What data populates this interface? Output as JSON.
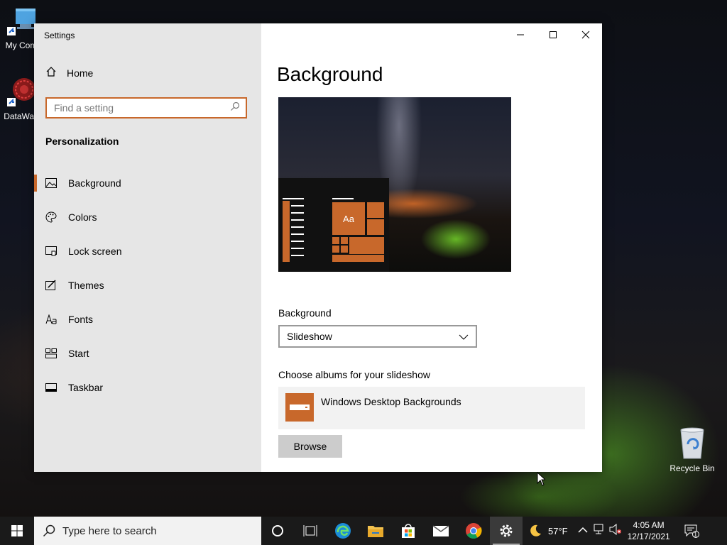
{
  "desktop": {
    "icons": [
      {
        "label": "My Com"
      },
      {
        "label": "DataWag"
      },
      {
        "label": "Recycle Bin"
      }
    ]
  },
  "window": {
    "title": "Settings"
  },
  "sidebar": {
    "home_label": "Home",
    "search_placeholder": "Find a setting",
    "section_title": "Personalization",
    "items": [
      {
        "label": "Background",
        "icon": "picture-icon",
        "active": true
      },
      {
        "label": "Colors",
        "icon": "palette-icon"
      },
      {
        "label": "Lock screen",
        "icon": "lock-screen-icon"
      },
      {
        "label": "Themes",
        "icon": "themes-icon"
      },
      {
        "label": "Fonts",
        "icon": "fonts-icon"
      },
      {
        "label": "Start",
        "icon": "start-icon"
      },
      {
        "label": "Taskbar",
        "icon": "taskbar-icon"
      }
    ]
  },
  "content": {
    "page_title": "Background",
    "preview_tile_label": "Aa",
    "background_label": "Background",
    "background_value": "Slideshow",
    "albums_label": "Choose albums for your slideshow",
    "album_name": "Windows Desktop Backgrounds",
    "browse_label": "Browse"
  },
  "taskbar": {
    "search_placeholder": "Type here to search",
    "weather": "57°F",
    "time": "4:05 AM",
    "date": "12/17/2021",
    "notification_count": "1"
  },
  "colors": {
    "accent": "#c8682b",
    "taskbar": "#1a1a1a",
    "sidebar": "#e6e6e6"
  }
}
